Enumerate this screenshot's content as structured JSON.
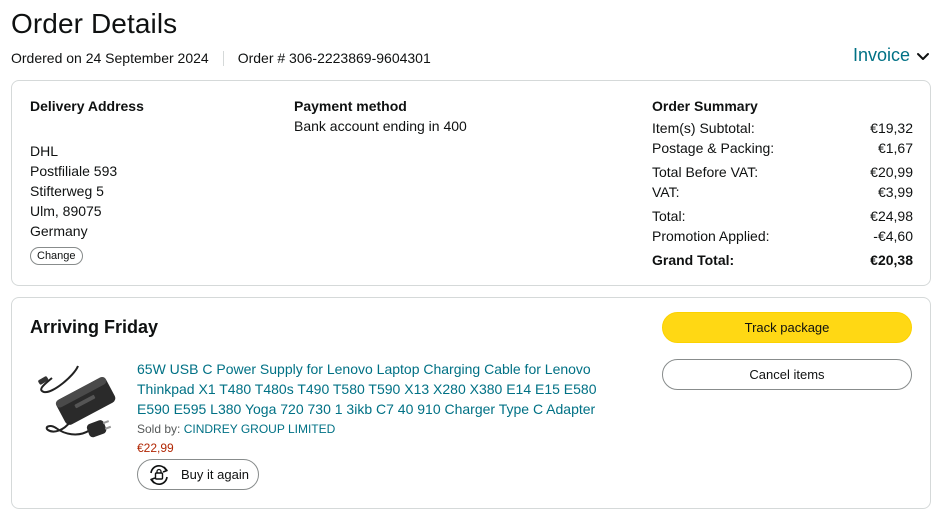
{
  "page": {
    "title": "Order Details",
    "ordered_on": "Ordered on 24 September 2024",
    "order_number": "Order # 306-2223869-9604301",
    "invoice_label": "Invoice"
  },
  "delivery": {
    "heading": "Delivery Address",
    "lines": [
      "DHL",
      "Postfiliale 593",
      "Stifterweg 5",
      "Ulm, 89075",
      "Germany"
    ],
    "change_label": "Change"
  },
  "payment": {
    "heading": "Payment method",
    "text": "Bank account ending in 400"
  },
  "summary": {
    "heading": "Order Summary",
    "rows": [
      {
        "label": "Item(s) Subtotal:",
        "value": "€19,32"
      },
      {
        "label": "Postage & Packing:",
        "value": "€1,67"
      },
      {
        "label": "Total Before VAT:",
        "value": "€20,99"
      },
      {
        "label": "VAT:",
        "value": "€3,99"
      },
      {
        "label": "Total:",
        "value": "€24,98"
      },
      {
        "label": "Promotion Applied:",
        "value": "-€4,60"
      },
      {
        "label": "Grand Total:",
        "value": "€20,38"
      }
    ]
  },
  "shipment": {
    "status": "Arriving Friday",
    "track_label": "Track package",
    "cancel_label": "Cancel items",
    "item": {
      "title": "65W USB C Power Supply for Lenovo Laptop Charging Cable for Lenovo Thinkpad X1 T480 T480s T490 T580 T590 X13 X280 X380 E14 E15 E580 E590 E595 L380 Yoga 720 730 1 3ikb C7 40 910 Charger Type C Adapter",
      "sold_by_label": "Sold by:",
      "seller": "CINDREY GROUP LIMITED",
      "price": "€22,99",
      "buy_again_label": "Buy it again"
    }
  },
  "colors": {
    "link": "#007185",
    "price": "#b12704",
    "track_button": "#ffd814",
    "border": "#d5d9d9"
  },
  "icons": [
    "chevron-down-icon",
    "buy-again-icon",
    "product-image"
  ]
}
